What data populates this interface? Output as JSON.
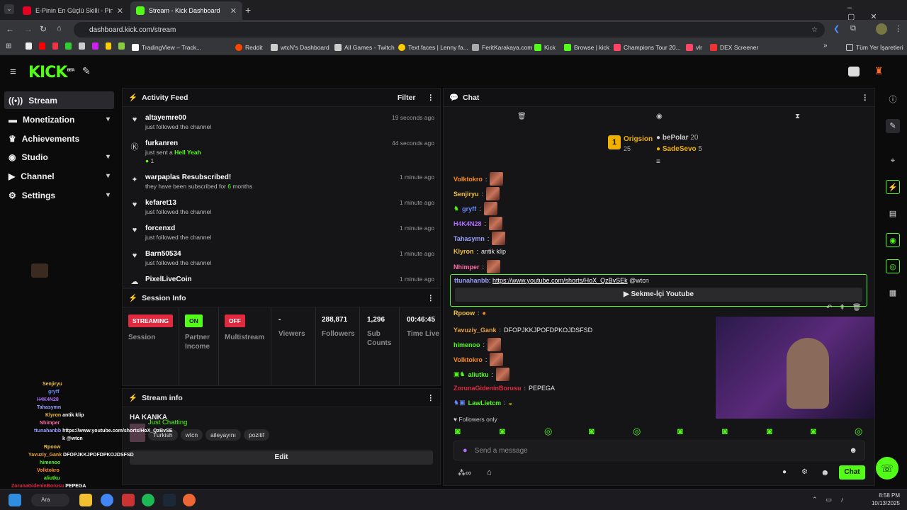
{
  "browser": {
    "tabs": [
      {
        "title": "E-Pinin En Güçlü Skilli - Pindiriri",
        "color": "#e60023"
      },
      {
        "title": "Stream - Kick Dashboard",
        "color": "#53fc18"
      }
    ],
    "url": "dashboard.kick.com/stream",
    "bookmarks": [
      "TradingView – Track...",
      "Reddit",
      "wtcN's Dashboard",
      "All Games - Twitch",
      "Text faces | Lenny fa...",
      "FeritKarakaya.com",
      "Kick",
      "Browse | kick",
      "Champions Tour 20...",
      "vlr",
      "DEX Screener"
    ],
    "all_bookmarks": "Tüm Yer İşaretleri"
  },
  "kick": {
    "logo": "KICK",
    "beta": "BETA"
  },
  "sidebar": {
    "items": [
      {
        "label": "Stream",
        "icon": "radio-icon"
      },
      {
        "label": "Monetization",
        "icon": "money-icon"
      },
      {
        "label": "Achievements",
        "icon": "trophy-icon"
      },
      {
        "label": "Studio",
        "icon": "studio-icon"
      },
      {
        "label": "Channel",
        "icon": "channel-icon"
      },
      {
        "label": "Settings",
        "icon": "gear-icon"
      }
    ]
  },
  "activity": {
    "title": "Activity Feed",
    "filter": "Filter",
    "items": [
      {
        "name": "altayemre00",
        "sub": "just followed the channel",
        "time": "19 seconds ago",
        "icon": "heart-icon"
      },
      {
        "name": "furkanren",
        "sub": "just sent a Hell Yeah",
        "time": "44 seconds ago",
        "icon": "kick-icon",
        "count": "1"
      },
      {
        "name": "warpaplas Resubscribed!",
        "sub": "they have been subscribed for 6 months",
        "time": "1 minute ago",
        "icon": "star-icon"
      },
      {
        "name": "kefaret13",
        "sub": "just followed the channel",
        "time": "1 minute ago",
        "icon": "heart-icon"
      },
      {
        "name": "forcenxd",
        "sub": "just followed the channel",
        "time": "1 minute ago",
        "icon": "heart-icon"
      },
      {
        "name": "Barn50534",
        "sub": "just followed the channel",
        "time": "1 minute ago",
        "icon": "heart-icon"
      },
      {
        "name": "PixelLiveCoin",
        "sub": "",
        "time": "1 minute ago",
        "icon": "cloud-icon"
      }
    ]
  },
  "session": {
    "title": "Session Info",
    "streaming": {
      "badge": "STREAMING",
      "label": "Session",
      "color": "#e02a40"
    },
    "partner": {
      "badge": "ON",
      "label": "Partner Income",
      "color": "#53fc18"
    },
    "multistream": {
      "badge": "OFF",
      "label": "Multistream",
      "color": "#e02a40"
    },
    "viewers": {
      "value": "-",
      "label": "Viewers"
    },
    "followers": {
      "value": "288,871",
      "label": "Followers"
    },
    "subs": {
      "value": "1,296",
      "label": "Sub Counts"
    },
    "time": {
      "value": "00:46:45",
      "label": "Time Live"
    }
  },
  "streaminfo": {
    "title": "Stream info",
    "stream_title": "HA KANKA",
    "category": "Just Chatting",
    "tags": [
      "Turkish",
      "wtcn",
      "aileyayını",
      "pozitif"
    ],
    "edit": "Edit"
  },
  "chat": {
    "title": "Chat",
    "leaderboard": [
      {
        "rank": "1",
        "name": "Origsion",
        "count": "25"
      },
      {
        "name": "bePolar",
        "count": "20"
      },
      {
        "name": "SadeSevo",
        "count": "5"
      }
    ],
    "messages": [
      {
        "user": "Volktokro",
        "color": "#ff8a1f",
        "text": ""
      },
      {
        "user": "Senjiryu",
        "color": "#f0c040",
        "text": ""
      },
      {
        "user": "gryff",
        "color": "#6a8cff",
        "text": ""
      },
      {
        "user": "H4K4N28",
        "color": "#b06cff",
        "text": ""
      },
      {
        "user": "Tahasymn",
        "color": "#9aa0ff",
        "text": ""
      },
      {
        "user": "Klyron",
        "color": "#f0c040",
        "text": "antik klip"
      },
      {
        "user": "Nhimper",
        "color": "#ff6aa2",
        "text": ""
      },
      {
        "user": "ttunahanbb",
        "color": "#9aa0ff",
        "text": "@wtcn",
        "link": "https://www.youtube.com/shorts/HoX_QzBvSEk"
      },
      {
        "user": "Rpoow",
        "color": "#f0c040",
        "text": ""
      },
      {
        "user": "Yavuziy_Gank",
        "color": "#e8a040",
        "text": "DFOPJKKJPOFDPKOJDSFSD"
      },
      {
        "user": "himenoo",
        "color": "#53fc18",
        "text": ""
      },
      {
        "user": "Volktokro",
        "color": "#ff8a1f",
        "text": ""
      },
      {
        "user": "aliutku",
        "color": "#53fc18",
        "text": ""
      },
      {
        "user": "ZorunaGideninBorusu",
        "color": "#e02a40",
        "text": "PEPEGA"
      },
      {
        "user": "LawLietcm",
        "color": "#53fc18",
        "text": ""
      }
    ],
    "youtube_button": "Sekme-İçi Youtube",
    "followers_only": "Followers only",
    "placeholder": "Send a message",
    "send": "Chat"
  },
  "overlay_chat": [
    {
      "user": "Senjiryu",
      "text": ""
    },
    {
      "user": "gryff",
      "text": ""
    },
    {
      "user": "H4K4N28",
      "text": ""
    },
    {
      "user": "Tahasymn",
      "text": ""
    },
    {
      "user": "Klyron",
      "text": "antik klip"
    },
    {
      "user": "Nhimper",
      "text": ""
    },
    {
      "user": "ttunahanbb",
      "text": "https://www.youtube.com/shorts/HoX_QzBvSE"
    },
    {
      "user": "",
      "text": "k @wtcn"
    },
    {
      "user": "Rpoow",
      "text": ""
    },
    {
      "user": "Yavuziy_Gank",
      "text": "DFOPJKKJPOFDPKOJDSFSD"
    },
    {
      "user": "himenoo",
      "text": ""
    },
    {
      "user": "Volktokro",
      "text": ""
    },
    {
      "user": "aliutku",
      "text": ""
    },
    {
      "user": "ZorunaGideninBorusu",
      "text": "PEPEGA"
    },
    {
      "user": "LawLietcm",
      "text": ""
    }
  ],
  "taskbar": {
    "search": "Ara",
    "time": "8:58 PM",
    "date": "10/13/2025"
  }
}
